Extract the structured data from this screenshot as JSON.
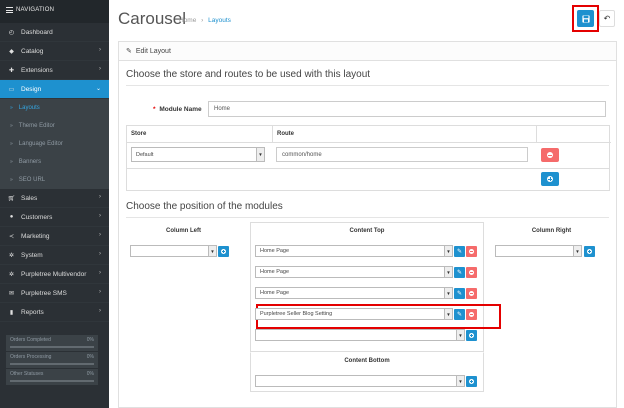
{
  "sidebar": {
    "header": "NAVIGATION",
    "items": [
      {
        "label": "Dashboard",
        "icon": "dashboard-icon"
      },
      {
        "label": "Catalog",
        "icon": "tag-icon"
      },
      {
        "label": "Extensions",
        "icon": "puzzle-icon"
      },
      {
        "label": "Design",
        "icon": "monitor-icon"
      }
    ],
    "sub_items": [
      "Layouts",
      "Theme Editor",
      "Language Editor",
      "Banners",
      "SEO URL"
    ],
    "items2": [
      {
        "label": "Sales",
        "icon": "cart-icon"
      },
      {
        "label": "Customers",
        "icon": "user-icon"
      },
      {
        "label": "Marketing",
        "icon": "share-icon"
      },
      {
        "label": "System",
        "icon": "cog-icon"
      },
      {
        "label": "Purpletree Multivendor",
        "icon": "gear-icon"
      },
      {
        "label": "Purpletree SMS",
        "icon": "envelope-icon"
      },
      {
        "label": "Reports",
        "icon": "bar-chart-icon"
      }
    ],
    "stats": [
      {
        "label": "Orders Completed",
        "pct": "0%",
        "fill": 0
      },
      {
        "label": "Orders Processing",
        "pct": "0%",
        "fill": 0
      },
      {
        "label": "Other Statuses",
        "pct": "0%",
        "fill": 0
      }
    ]
  },
  "header": {
    "title": "Carousel",
    "breadcrumb_home": "Home",
    "breadcrumb_sep": "›",
    "breadcrumb_current": "Layouts"
  },
  "panel": {
    "heading": "Edit Layout",
    "section1": "Choose the store and routes to be used with this layout",
    "module_name_label": "Module Name",
    "module_name_required": "*",
    "module_name_value": "Home",
    "col_store": "Store",
    "col_route": "Route",
    "store_value": "Default",
    "route_value": "common/home",
    "section2": "Choose the position of the modules",
    "column_left": "Column Left",
    "content_top": "Content Top",
    "column_right": "Column Right",
    "content_bottom": "Content Bottom",
    "content_top_modules": [
      "Home Page",
      "Home Page",
      "Home Page",
      "Purpletree Seller Blog Setting"
    ]
  },
  "colors": {
    "accent": "#1e91cf",
    "danger": "#f56b6b",
    "highlight": "#e40000",
    "sidebar": "#2b3035"
  }
}
